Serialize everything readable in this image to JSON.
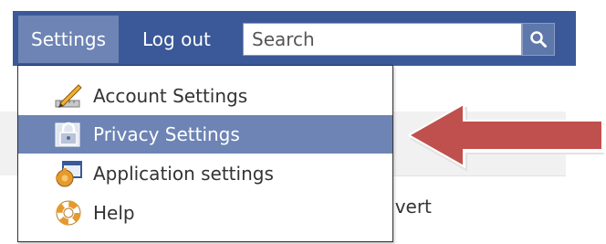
{
  "nav": {
    "settings_label": "Settings",
    "logout_label": "Log out",
    "search_placeholder": "Search",
    "search_icon": "magnifier-icon"
  },
  "dropdown": {
    "items": [
      {
        "label": "Account Settings",
        "icon": "pencil-ruler-icon"
      },
      {
        "label": "Privacy Settings",
        "icon": "padlock-icon",
        "highlighted": true
      },
      {
        "label": "Application settings",
        "icon": "puzzle-window-icon"
      },
      {
        "label": "Help",
        "icon": "lifebuoy-icon"
      }
    ]
  },
  "background": {
    "partial_text": "dvert"
  },
  "annotation": {
    "arrow_icon": "red-arrow-left-icon",
    "arrow_color": "#c0504d"
  },
  "colors": {
    "navbar": "#3b5998",
    "highlight": "#6d84b4"
  }
}
